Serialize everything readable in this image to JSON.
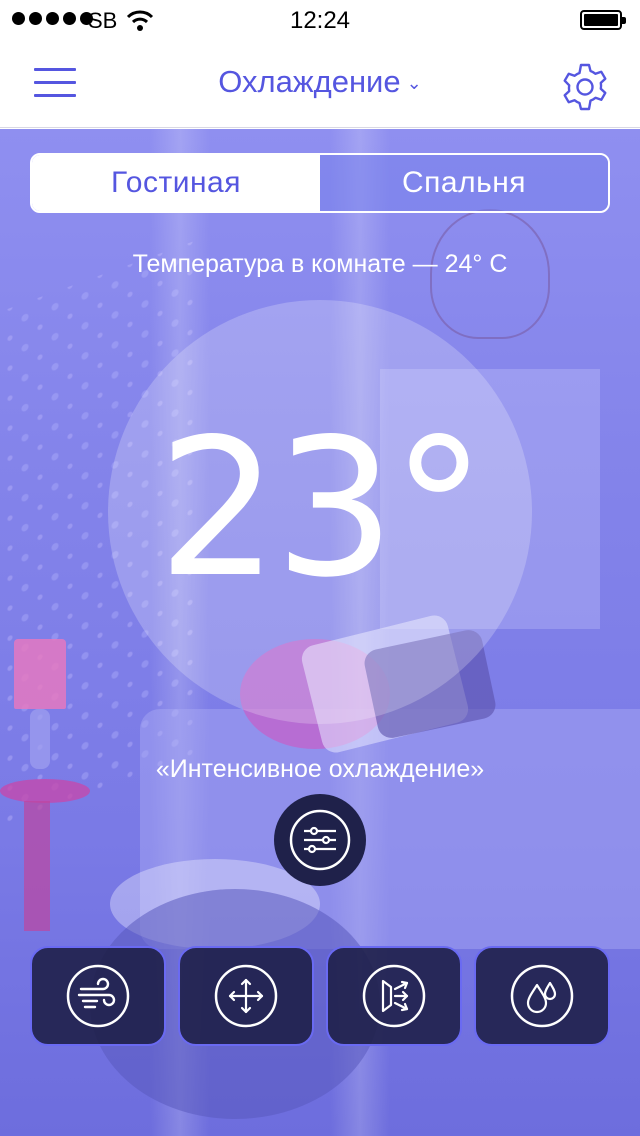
{
  "status_bar": {
    "carrier": "SB",
    "time": "12:24",
    "signal_icon": "signal-dots-icon",
    "wifi_icon": "wifi-icon",
    "battery_icon": "battery-icon",
    "battery_level": 1.0
  },
  "nav": {
    "title": "Охлаждение",
    "menu_icon": "hamburger-menu-icon",
    "dropdown_icon": "chevron-down-icon",
    "settings_icon": "gear-icon"
  },
  "rooms": {
    "tabs": [
      {
        "label": "Гостиная",
        "selected": true
      },
      {
        "label": "Спальня",
        "selected": false
      }
    ]
  },
  "climate": {
    "room_temperature_text": "Температура в комнате — 24° C",
    "target_temperature": "23°",
    "mode_text": "«Интенсивное охлаждение»"
  },
  "controls": {
    "settings_icon": "sliders-icon",
    "actions": [
      {
        "icon": "wind-icon"
      },
      {
        "icon": "move-arrows-icon"
      },
      {
        "icon": "airflow-direction-icon"
      },
      {
        "icon": "humidity-drops-icon"
      }
    ]
  },
  "colors": {
    "accent": "#5556e0",
    "dark_button": "#1f214a",
    "overlay": "#8383ea"
  }
}
